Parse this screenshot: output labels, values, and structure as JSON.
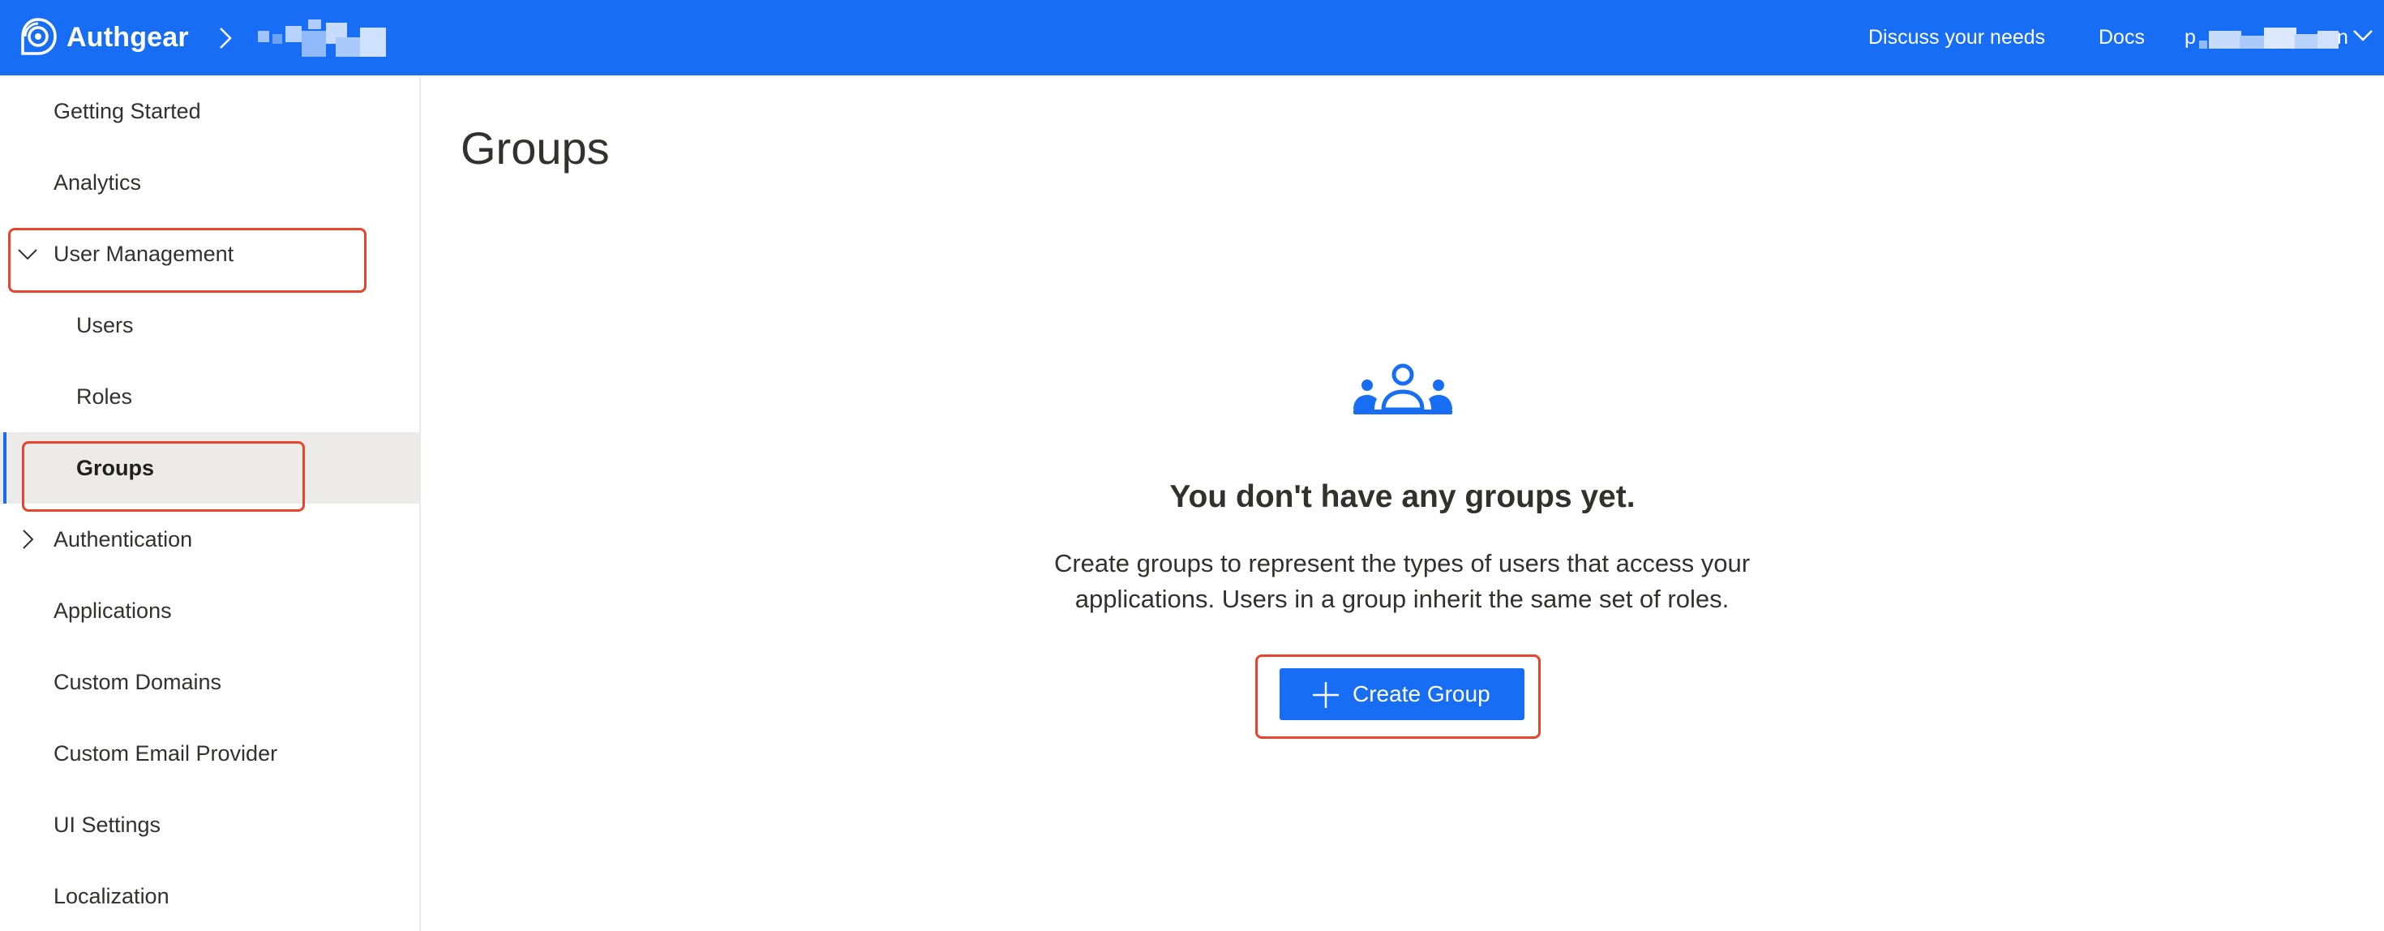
{
  "header": {
    "brand": "Authgear",
    "nav": {
      "discuss": "Discuss your needs",
      "docs": "Docs"
    },
    "account_initial": "p",
    "account_end": "n"
  },
  "sidebar": {
    "items": [
      {
        "label": "Getting Started"
      },
      {
        "label": "Analytics"
      },
      {
        "label": "User Management",
        "expanded": true
      },
      {
        "label": "Users"
      },
      {
        "label": "Roles"
      },
      {
        "label": "Groups",
        "selected": true
      },
      {
        "label": "Authentication",
        "expanded": false
      },
      {
        "label": "Applications"
      },
      {
        "label": "Custom Domains"
      },
      {
        "label": "Custom Email Provider"
      },
      {
        "label": "UI Settings"
      },
      {
        "label": "Localization"
      }
    ]
  },
  "main": {
    "title": "Groups",
    "empty_state": {
      "icon": "people-group-icon",
      "title": "You don't have any groups yet.",
      "description": "Create groups to represent the types of users that access your applications. Users in a group inherit the same set of roles.",
      "button_label": "Create Group"
    }
  },
  "colors": {
    "accent": "#176df3",
    "highlight": "#e8452c",
    "selected_bg": "#edebe9",
    "text": "#323130"
  }
}
